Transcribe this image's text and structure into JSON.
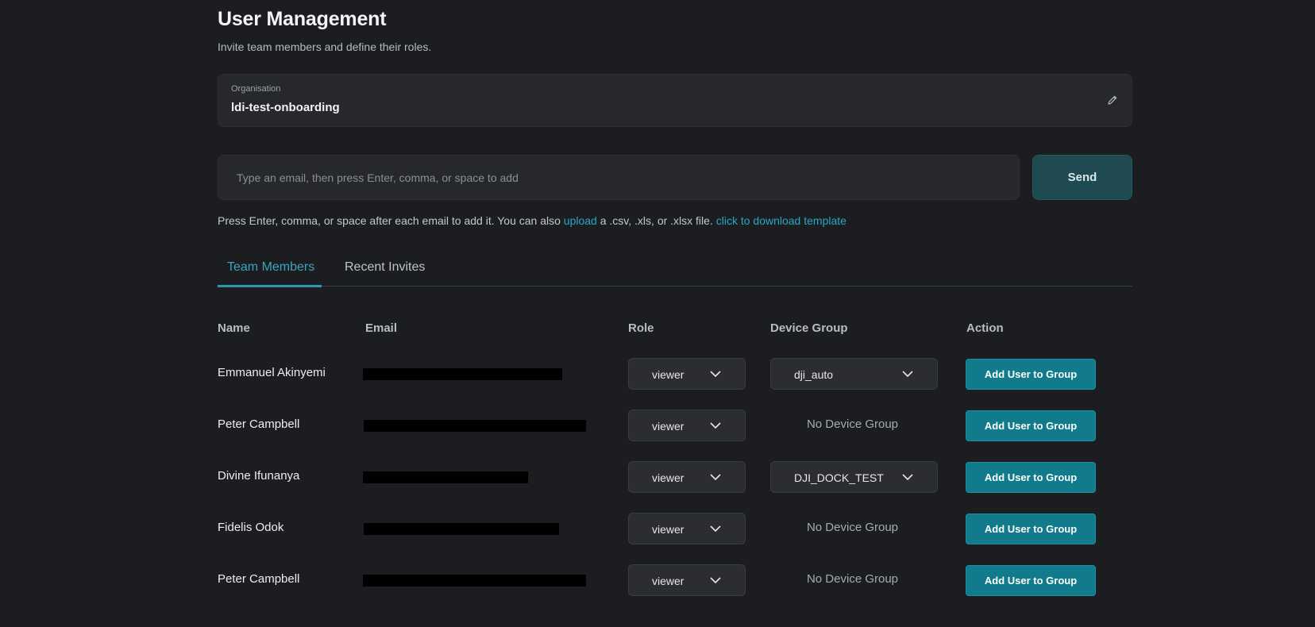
{
  "header": {
    "title": "User Management",
    "subtitle": "Invite team members and define their roles."
  },
  "organisation": {
    "label": "Organisation",
    "value": "ldi-test-onboarding"
  },
  "invite": {
    "placeholder": "Type an email, then press Enter, comma, or space to add",
    "send_label": "Send",
    "help_prefix": "Press Enter, comma, or space after each email to add it. You can also ",
    "upload_link": "upload",
    "help_middle": " a .csv, .xls, or .xlsx file. ",
    "template_link": "click to download template"
  },
  "tabs": [
    {
      "label": "Team Members",
      "active": true
    },
    {
      "label": "Recent Invites",
      "active": false
    }
  ],
  "table": {
    "columns": [
      "Name",
      "Email",
      "Role",
      "Device Group",
      "Action"
    ],
    "rows": [
      {
        "name": "Emmanuel Akinyemi",
        "role": "viewer",
        "device_group": "dji_auto",
        "action": "Add User to Group"
      },
      {
        "name": "Peter Campbell",
        "role": "viewer",
        "device_group": "No Device Group",
        "action": "Add User to Group"
      },
      {
        "name": "Divine Ifunanya",
        "role": "viewer",
        "device_group": "DJI_DOCK_TEST",
        "action": "Add User to Group"
      },
      {
        "name": "Fidelis Odok",
        "role": "viewer",
        "device_group": "No Device Group",
        "action": "Add User to Group"
      },
      {
        "name": "Peter Campbell",
        "role": "viewer",
        "device_group": "No Device Group",
        "action": "Add User to Group"
      }
    ]
  },
  "colors": {
    "background": "#1b1d21",
    "accent": "#2a98b2",
    "action_button": "#117a8b",
    "send_button": "#1f4a52"
  },
  "icons": {
    "edit": "pencil-icon",
    "dropdown": "chevron-down-icon"
  }
}
